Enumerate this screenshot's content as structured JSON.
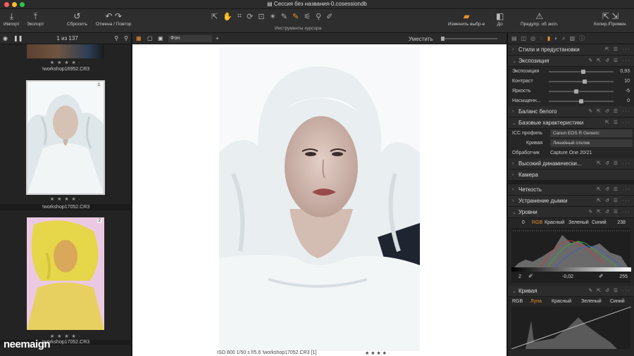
{
  "window": {
    "title": "Сессия без названия-0.cosessiondb"
  },
  "toolbar": {
    "import": "Импорт",
    "export": "Экспорт",
    "reset": "Сбросить",
    "undo_redo": "Отмена / Повтор",
    "cursor_tools": "Инструменты курсора",
    "change_select": "Изменить выбр-е",
    "before": "До",
    "warn": "Предупр. об эксп.",
    "copy_apply": "Копир./Примен."
  },
  "browser": {
    "counter": "1 из 137",
    "items": [
      {
        "filename": "!workshop16952.CR3",
        "stars": "★ ★ ★ ★ ·"
      },
      {
        "filename": "!workshop17052.CR3",
        "stars": "★ ★ ★ ★ ·",
        "badge": "1"
      },
      {
        "filename": "!workshop17052.CR3",
        "stars": "★ ★ ★ ★ ·",
        "badge": "2"
      }
    ]
  },
  "viewer": {
    "layer": "Фон",
    "fit": "Уместить",
    "status": "ISO 800     1/50 s     f/5.6     !workshop17052.CR3 [1]",
    "stars": "★ ★ ★ ★ ·"
  },
  "watermark": "neemaign",
  "tools": {
    "styles": "Стили и предустановки",
    "exposure": {
      "title": "Экспозиция",
      "rows": [
        {
          "label": "Экспозиция",
          "value": "0,93"
        },
        {
          "label": "Контраст",
          "value": "10"
        },
        {
          "label": "Яркость",
          "value": "-5"
        },
        {
          "label": "Насыщенн...",
          "value": "0"
        }
      ]
    },
    "white_balance": "Баланс белого",
    "base": {
      "title": "Базовые характеристики",
      "icc_label": "ICC профиль",
      "icc_value": "Canon EOS R Generic",
      "curve_label": "Кривая",
      "curve_value": "Линейный отклик",
      "engine_label": "Обработчик",
      "engine_value": "Capture One 20/21"
    },
    "hdr": "Высокий динамически...",
    "camera": "Камера",
    "clarity": "Четкость",
    "dehaze": "Устранение дымки",
    "levels": {
      "title": "Уровни",
      "low_out": "0",
      "high_out": "238",
      "tabs": [
        "RGB",
        "Красный",
        "Зеленый",
        "Синий"
      ],
      "low_in": "2",
      "mid": "-0,02",
      "high_in": "255"
    },
    "curve": {
      "title": "Кривая",
      "tabs": [
        "RGB",
        "Луна",
        "Красный",
        "Зеленый",
        "Синий"
      ]
    }
  },
  "colors": {
    "accent": "#e8902e",
    "bg": "#1c1c1c",
    "panel": "#262626"
  }
}
